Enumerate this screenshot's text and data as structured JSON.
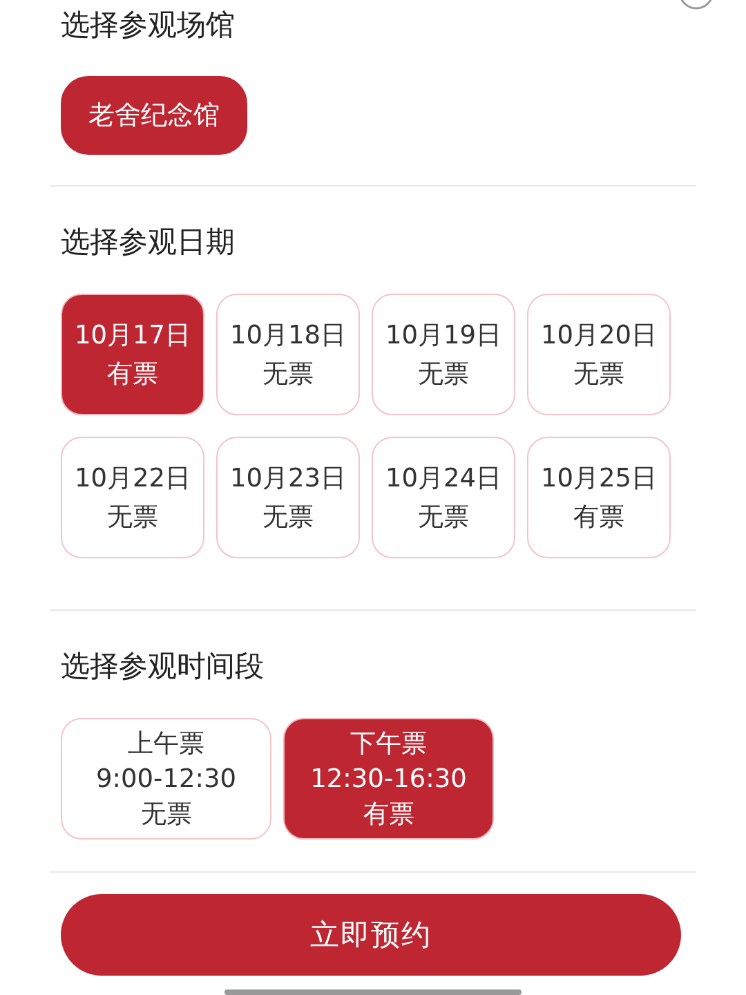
{
  "venue": {
    "title": "选择参观场馆",
    "options": [
      {
        "label": "老舍纪念馆",
        "selected": true
      }
    ]
  },
  "date": {
    "title": "选择参观日期",
    "options": [
      {
        "date": "10月17日",
        "status": "有票",
        "selected": true
      },
      {
        "date": "10月18日",
        "status": "无票",
        "selected": false
      },
      {
        "date": "10月19日",
        "status": "无票",
        "selected": false
      },
      {
        "date": "10月20日",
        "status": "无票",
        "selected": false
      },
      {
        "date": "10月22日",
        "status": "无票",
        "selected": false
      },
      {
        "date": "10月23日",
        "status": "无票",
        "selected": false
      },
      {
        "date": "10月24日",
        "status": "无票",
        "selected": false
      },
      {
        "date": "10月25日",
        "status": "有票",
        "selected": false
      }
    ]
  },
  "session": {
    "title": "选择参观时间段",
    "options": [
      {
        "name": "上午票",
        "time": "9:00-12:30",
        "status": "无票",
        "selected": false
      },
      {
        "name": "下午票",
        "time": "12:30-16:30",
        "status": "有票",
        "selected": true
      }
    ]
  },
  "submit": {
    "label": "立即预约"
  }
}
